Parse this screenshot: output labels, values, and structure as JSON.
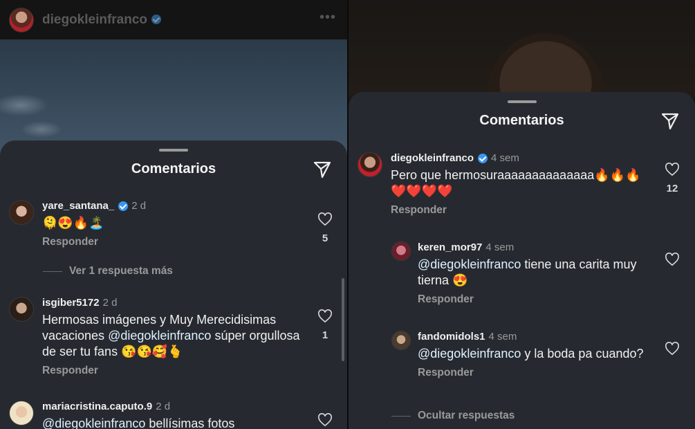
{
  "left": {
    "header": {
      "username": "diegokleinfranco",
      "more_icon": "more-horizontal-icon"
    },
    "sheet": {
      "title": "Comentarios"
    },
    "comments": [
      {
        "username": "yare_santana_",
        "verified": true,
        "time": "2 d",
        "text": "🫠😍🔥🏝️",
        "reply_label": "Responder",
        "likes": "5",
        "view_more": "Ver 1 respuesta más"
      },
      {
        "username": "isgiber5172",
        "time": "2 d",
        "text_before": "Hermosas imágenes  y Muy Merecidisimas vacaciones ",
        "mention": "@diegokleinfranco",
        "text_after": " súper orgullosa  de ser tu fans 😘😘🥰🫰",
        "reply_label": "Responder",
        "likes": "1"
      },
      {
        "username": "mariacristina.caputo.9",
        "time": "2 d",
        "mention": "@diegokleinfranco",
        "text_after": " bellísimas fotos"
      }
    ]
  },
  "right": {
    "sheet": {
      "title": "Comentarios"
    },
    "main_comment": {
      "username": "diegokleinfranco",
      "verified": true,
      "time": "4 sem",
      "text": "Pero que hermosuraaaaaaaaaaaaaa🔥🔥🔥❤️❤️❤️❤️",
      "reply_label": "Responder",
      "likes": "12"
    },
    "replies": [
      {
        "username": "keren_mor97",
        "time": "4 sem",
        "mention": "@diegokleinfranco",
        "text_after": " tiene una carita muy tierna 😍",
        "reply_label": "Responder"
      },
      {
        "username": "fandomidols1",
        "time": "4 sem",
        "mention": "@diegokleinfranco",
        "text_after": " y la boda pa cuando?",
        "reply_label": "Responder"
      }
    ],
    "hide_replies": "Ocultar respuestas"
  },
  "colors": {
    "sheet": "#262a30",
    "verified": "#3897f0",
    "mention": "#e0f1ff",
    "muted": "#9a9a9a"
  }
}
